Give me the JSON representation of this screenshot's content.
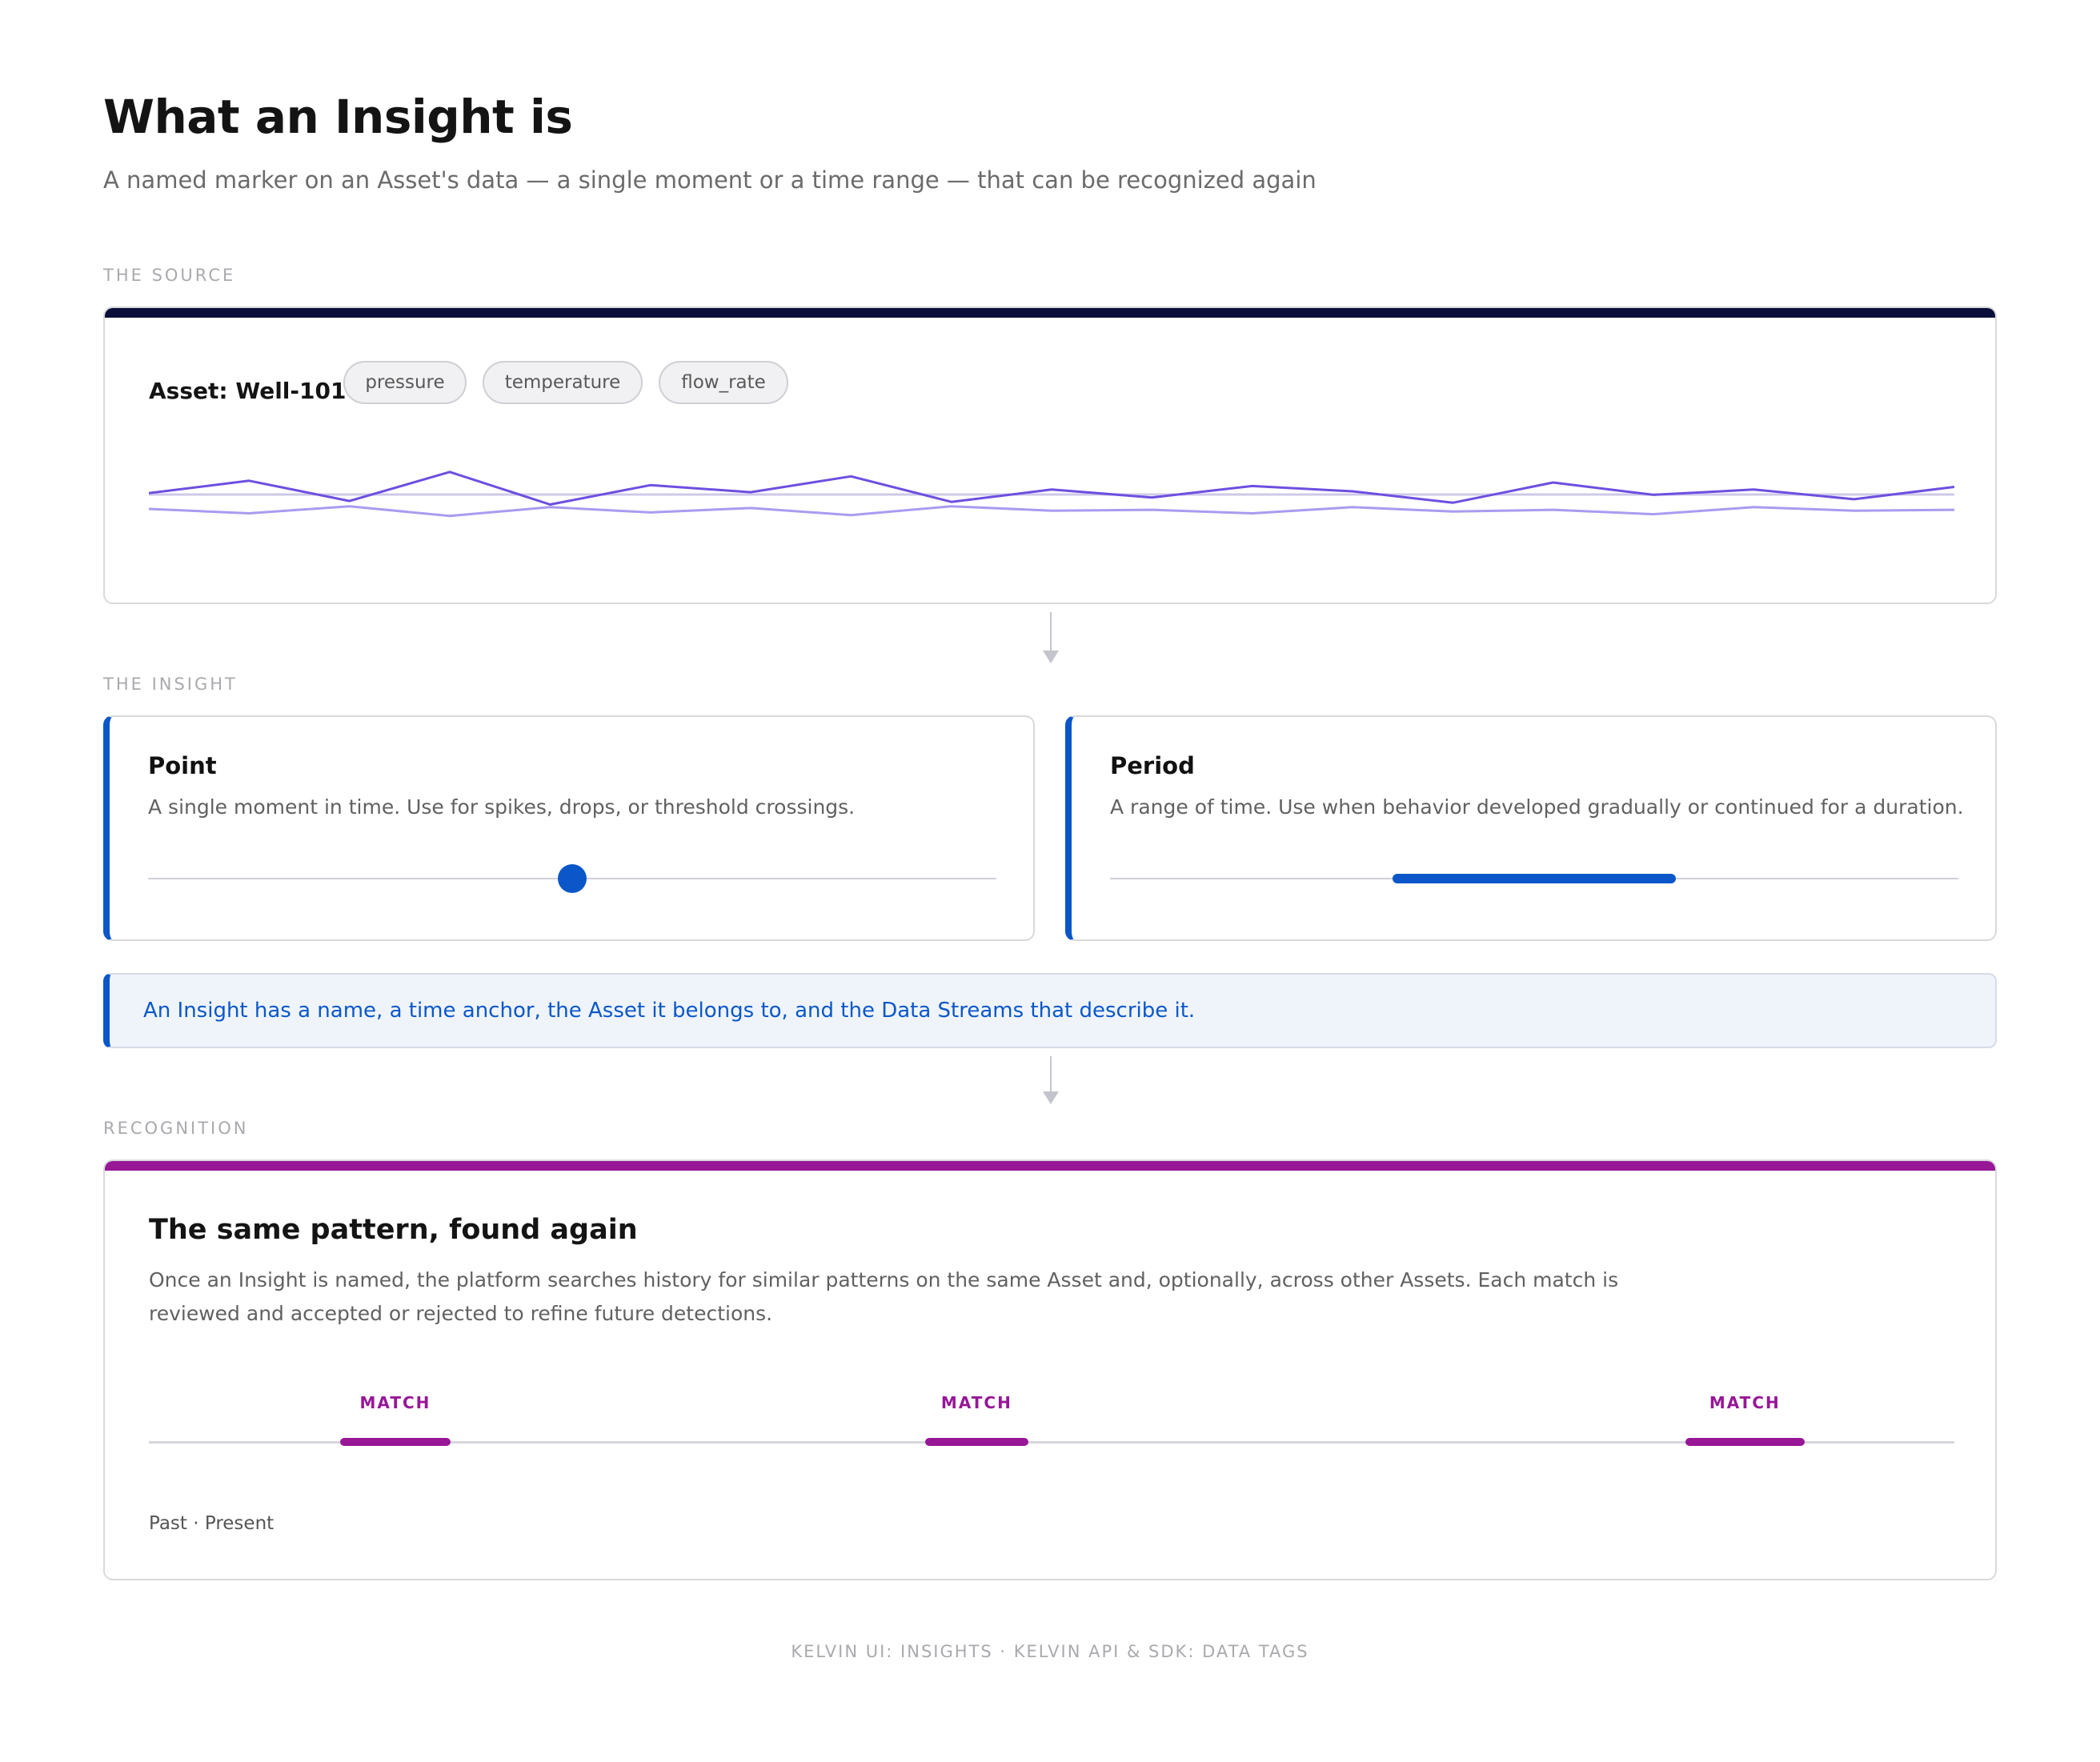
{
  "header": {
    "title": "What an Insight is",
    "subtitle": "A named marker on an Asset's data — a single moment or a time range — that can be recognized again"
  },
  "source": {
    "section_label": "THE SOURCE",
    "asset_label": "Asset: Well-101",
    "streams": [
      "pressure",
      "temperature",
      "flow_rate"
    ],
    "accent_color": "#0a0f3a",
    "line_colors": [
      "#6e4fe0",
      "#a99bf0",
      "#cfcae8"
    ],
    "signal_a": [
      58,
      72,
      49,
      82,
      45,
      67,
      59,
      77,
      48,
      62,
      53,
      66,
      60,
      47,
      70,
      56,
      62,
      51,
      65
    ],
    "signal_b": [
      40,
      35,
      43,
      32,
      42,
      36,
      41,
      33,
      43,
      38,
      39,
      35,
      42,
      37,
      39,
      34,
      42,
      38,
      39
    ]
  },
  "insight": {
    "section_label": "THE INSIGHT",
    "accent_color": "#0b57c9",
    "point": {
      "title": "Point",
      "description": "A single moment in time. Use for spikes, drops, or threshold crossings.",
      "position": 0.5
    },
    "period": {
      "title": "Period",
      "description": "A range of time. Use when behavior developed gradually or continued for a duration.",
      "range": [
        0.333,
        0.667
      ]
    },
    "note": "An Insight has a name, a time anchor, the Asset it belongs to, and the Data Streams that describe it."
  },
  "recognition": {
    "section_label": "RECOGNITION",
    "accent_color": "#971797",
    "title": "The same pattern, found again",
    "description": "Once an Insight is named, the platform searches history for similar patterns on the same Asset and, optionally, across other Assets. Each match is reviewed and accepted or rejected to refine future detections.",
    "matches": [
      {
        "label": "MATCH",
        "range": [
          0.106,
          0.167
        ]
      },
      {
        "label": "MATCH",
        "range": [
          0.43,
          0.487
        ]
      },
      {
        "label": "MATCH",
        "range": [
          0.851,
          0.917
        ]
      }
    ],
    "timeline_caption": "Past · Present"
  },
  "footer": {
    "sources": "KELVIN UI: INSIGHTS · KELVIN API & SDK: DATA TAGS"
  }
}
